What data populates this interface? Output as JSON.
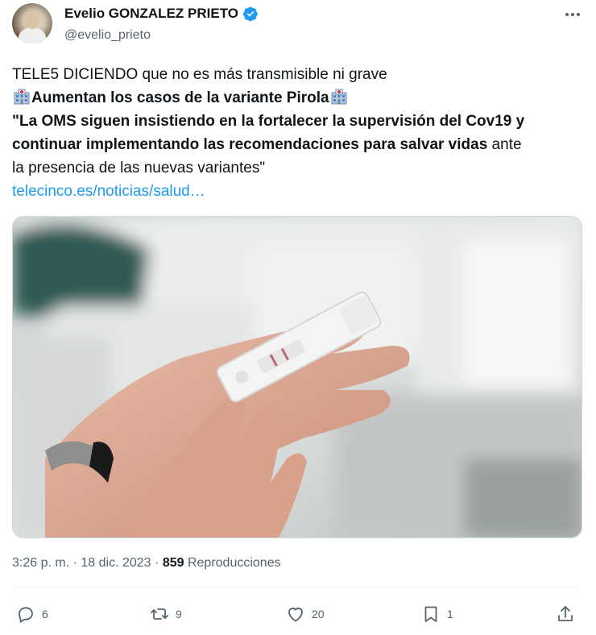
{
  "author": {
    "name": "Evelio GONZALEZ PRIETO",
    "handle": "@evelio_prieto",
    "verified": true
  },
  "tweet": {
    "line1": "TELE5 DICIENDO que no es más transmisible ni grave",
    "headline": "Aumentan los casos de la variante Pirola",
    "quote_bold_1": "\"La OMS siguen insistiendo en la fortalecer la supervisión del Cov19 y",
    "quote_bold_2": "continuar implementando las recomendaciones para salvar vidas",
    "quote_plain_2": " ante",
    "quote_plain_3": "la presencia de las nuevas variantes\"",
    "link": "telecinco.es/noticias/salud…"
  },
  "emoji": {
    "name": "hospital-emoji"
  },
  "media": {
    "alt": "photo-hands-holding-covid-test"
  },
  "meta": {
    "time": "3:26 p. m.",
    "separator": "·",
    "date": "18 dic. 2023",
    "views_count": "859",
    "views_label": "Reproducciones"
  },
  "actions": {
    "replies": "6",
    "retweets": "9",
    "likes": "20",
    "bookmarks": "1"
  },
  "colors": {
    "link": "#1d9bf0",
    "secondary_text": "#536471",
    "verified": "#1d9bf0"
  }
}
